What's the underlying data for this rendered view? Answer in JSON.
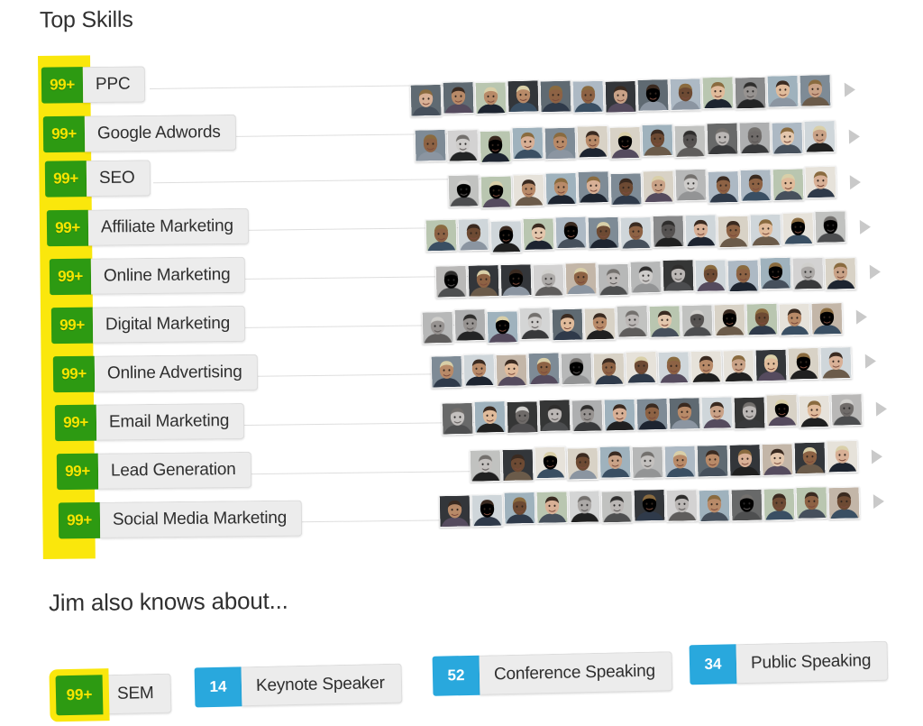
{
  "header": {
    "title": "Top Skills"
  },
  "also_knows": {
    "heading": "Jim also knows about...",
    "chips": [
      {
        "count": "99+",
        "label": "SEM",
        "highlighted": true,
        "badge_color": "#2d9a12"
      },
      {
        "count": "14",
        "label": "Keynote Speaker",
        "highlighted": false,
        "badge_color": "#29a8dd"
      },
      {
        "count": "52",
        "label": "Conference Speaking",
        "highlighted": false,
        "badge_color": "#29a8dd"
      },
      {
        "count": "34",
        "label": "Public Speaking",
        "highlighted": false,
        "badge_color": "#29a8dd"
      }
    ]
  },
  "skills": {
    "highlight_color": "#fae70c",
    "badge_color": "#2d9a12",
    "badge_text_color": "#f6e500",
    "items": [
      {
        "count": "99+",
        "label": "PPC",
        "endorsers": 13
      },
      {
        "count": "99+",
        "label": "Google Adwords",
        "endorsers": 13
      },
      {
        "count": "99+",
        "label": "SEO",
        "endorsers": 12
      },
      {
        "count": "99+",
        "label": "Affiliate Marketing",
        "endorsers": 13
      },
      {
        "count": "99+",
        "label": "Online Marketing",
        "endorsers": 13
      },
      {
        "count": "99+",
        "label": "Digital Marketing",
        "endorsers": 13
      },
      {
        "count": "99+",
        "label": "Online Advertising",
        "endorsers": 13
      },
      {
        "count": "99+",
        "label": "Email Marketing",
        "endorsers": 13
      },
      {
        "count": "99+",
        "label": "Lead Generation",
        "endorsers": 12
      },
      {
        "count": "99+",
        "label": "Social Media Marketing",
        "endorsers": 13
      }
    ]
  },
  "icons": {
    "more_endorsers": "chevron-right-icon"
  }
}
